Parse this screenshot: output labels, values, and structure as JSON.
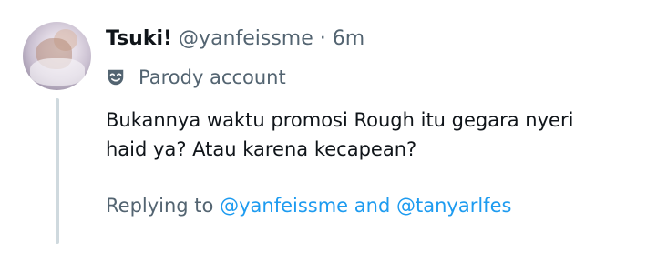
{
  "tweet": {
    "display_name": "Tsuki!",
    "handle": "@yanfeissme",
    "separator": "·",
    "time": "6m",
    "parody_label": "Parody account",
    "text": "Bukannya waktu promosi Rough itu gegara nyeri\nhaid ya? Atau karena kecapean?",
    "replying_prefix": "Replying to",
    "reply_mention_1": "@yanfeissme",
    "reply_join": "and",
    "reply_mention_2": "@tanyarlfes"
  },
  "icons": {
    "parody": "theater-mask-icon"
  },
  "colors": {
    "text_primary": "#0f1419",
    "text_secondary": "#536471",
    "link": "#1d9bf0",
    "thread_line": "#cfd9de"
  }
}
